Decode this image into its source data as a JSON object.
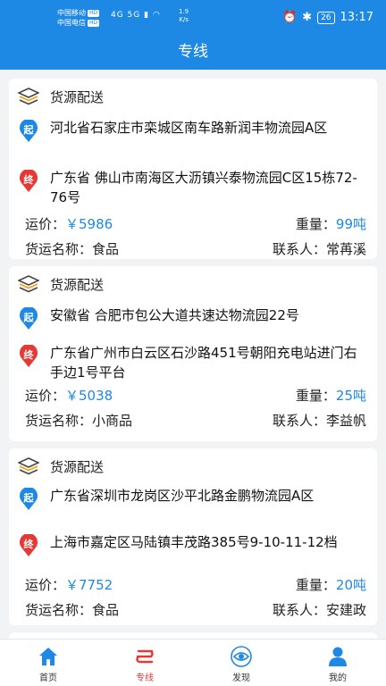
{
  "status_bar": {
    "carrier1": "中国移动",
    "carrier2": "中国电信",
    "hd": "HD",
    "network": "4G 5G",
    "speed_value": "1.9",
    "speed_unit": "K/s",
    "battery": "26",
    "time": "13:17"
  },
  "header": {
    "title": "专线"
  },
  "cards": [
    {
      "type": "货源配送",
      "origin_badge": "起",
      "origin": "河北省石家庄市栾城区南车路新润丰物流园A区",
      "dest_badge": "终",
      "destination": "广东省 佛山市南海区大沥镇兴泰物流园C区15栋72-76号",
      "freight_label": "运价：",
      "freight": "￥5986",
      "weight_label": "重量：",
      "weight": "99吨",
      "goods_label": "货运名称：",
      "goods": "食品",
      "contact_label": "联系人：",
      "contact": "常苒溪"
    },
    {
      "type": "货源配送",
      "origin_badge": "起",
      "origin": "安徽省 合肥市包公大道共速达物流园22号",
      "dest_badge": "终",
      "destination": "广东省广州市白云区石沙路451号朝阳充电站进门右手边1号平台",
      "freight_label": "运价：",
      "freight": "￥5038",
      "weight_label": "重量：",
      "weight": "25吨",
      "goods_label": "货运名称：",
      "goods": "小商品",
      "contact_label": "联系人：",
      "contact": "李益帆"
    },
    {
      "type": "货源配送",
      "origin_badge": "起",
      "origin": "广东省深圳市龙岗区沙平北路金鹏物流园A区",
      "dest_badge": "终",
      "destination": "上海市嘉定区马陆镇丰茂路385号9-10-11-12档",
      "freight_label": "运价：",
      "freight": "￥7752",
      "weight_label": "重量：",
      "weight": "20吨",
      "goods_label": "货运名称：",
      "goods": "食品",
      "contact_label": "联系人：",
      "contact": "安建政"
    }
  ],
  "bottom_nav": [
    {
      "label": "首页",
      "icon": "home-icon"
    },
    {
      "label": "专线",
      "icon": "route-icon",
      "active": true
    },
    {
      "label": "发现",
      "icon": "eye-icon"
    },
    {
      "label": "我的",
      "icon": "user-icon"
    }
  ],
  "colors": {
    "primary": "#1e88e5",
    "origin_pin": "#1e88e5",
    "dest_pin": "#e53935",
    "active_nav": "#e53935"
  }
}
